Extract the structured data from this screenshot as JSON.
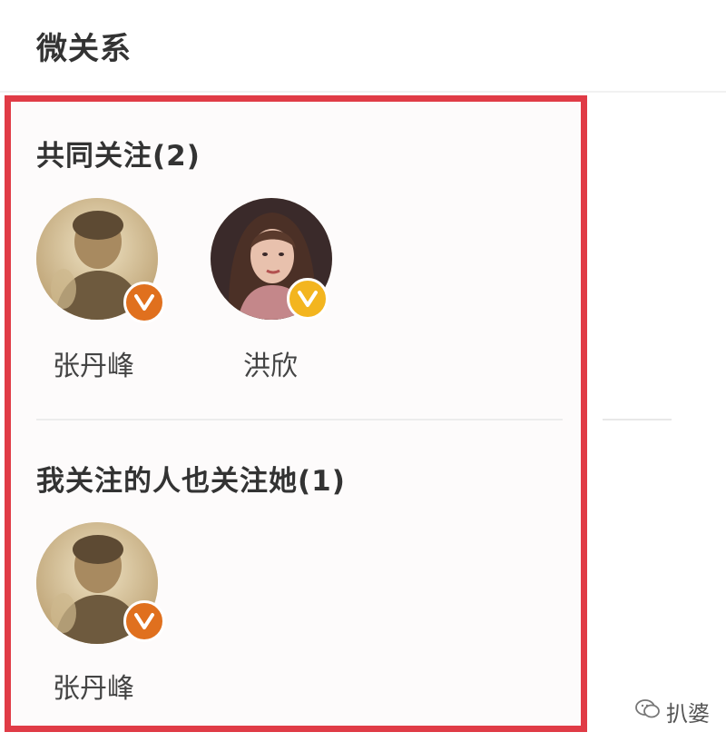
{
  "page": {
    "title": "微关系"
  },
  "sections": [
    {
      "title": "共同关注(2)",
      "users": [
        {
          "name": "张丹峰",
          "avatar": "man-portrait",
          "badge": "verified-orange-v-icon",
          "badge_color": "#e0701e"
        },
        {
          "name": "洪欣",
          "avatar": "woman-portrait",
          "badge": "verified-yellow-v-icon",
          "badge_color": "#f3b51f"
        }
      ]
    },
    {
      "title": "我关注的人也关注她(1)",
      "users": [
        {
          "name": "张丹峰",
          "avatar": "man-portrait",
          "badge": "verified-orange-v-icon",
          "badge_color": "#e0701e"
        }
      ]
    }
  ],
  "highlight": {
    "color": "#e03b46"
  },
  "watermark": {
    "text": "扒婆",
    "icon": "wechat-icon"
  }
}
